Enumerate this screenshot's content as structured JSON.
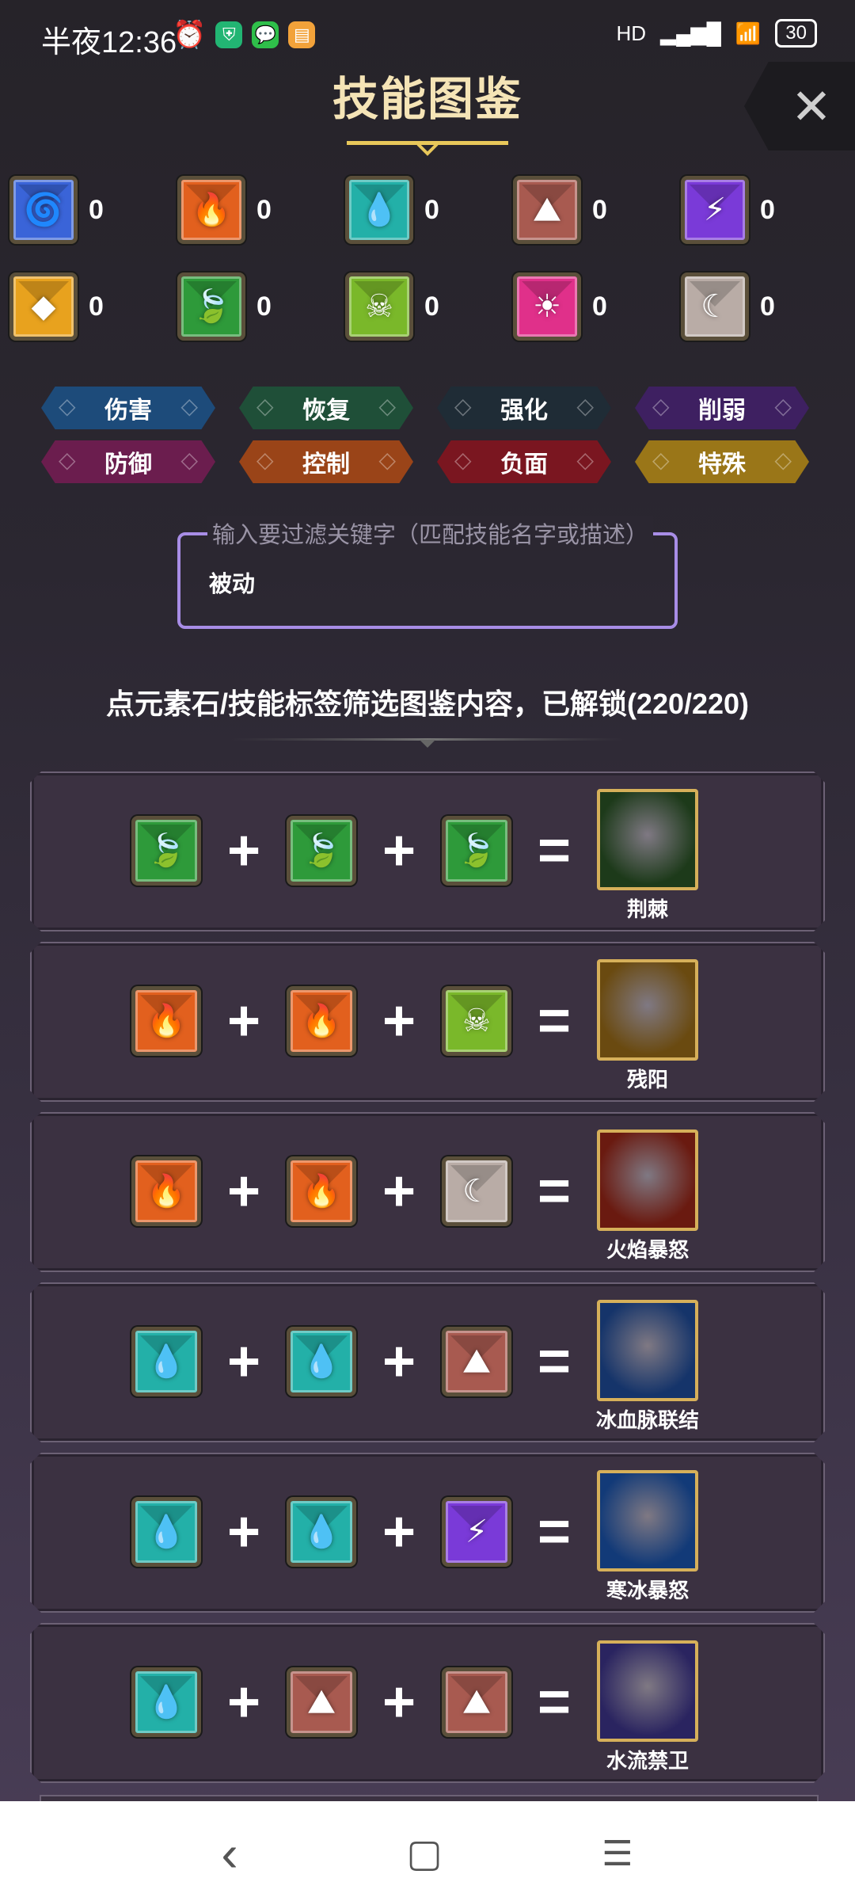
{
  "status_bar": {
    "time": "半夜12:36",
    "network": "HD",
    "battery": "30"
  },
  "page": {
    "title": "技能图鉴",
    "close_glyph": "✕"
  },
  "elements": [
    {
      "name": "wind",
      "icon": "tornado-icon",
      "glyph": "🌀",
      "color": "#3a64d8",
      "count": "0"
    },
    {
      "name": "fire",
      "icon": "flame-icon",
      "glyph": "🔥",
      "color": "#e2601e",
      "count": "0"
    },
    {
      "name": "water",
      "icon": "water-drop-icon",
      "glyph": "💧",
      "color": "#23b0a8",
      "count": "0"
    },
    {
      "name": "earth",
      "icon": "rock-icon",
      "glyph": "⛰",
      "color": "#a85a50",
      "count": "0"
    },
    {
      "name": "thunder",
      "icon": "lightning-icon",
      "glyph": "⚡",
      "color": "#7a3ad8",
      "count": "0"
    },
    {
      "name": "metal",
      "icon": "gold-gem-icon",
      "glyph": "◆",
      "color": "#e8a21e",
      "count": "0"
    },
    {
      "name": "wood",
      "icon": "leaf-icon",
      "glyph": "🍃",
      "color": "#2e9a3a",
      "count": "0"
    },
    {
      "name": "poison",
      "icon": "skull-icon",
      "glyph": "☠",
      "color": "#7ab82a",
      "count": "0"
    },
    {
      "name": "light",
      "icon": "sun-icon",
      "glyph": "☀",
      "color": "#e0308a",
      "count": "0"
    },
    {
      "name": "dark",
      "icon": "moon-icon",
      "glyph": "☾",
      "color": "#b9aca6",
      "count": "0"
    }
  ],
  "tags": [
    {
      "label": "伤害",
      "color": "#1d4b7a"
    },
    {
      "label": "恢复",
      "color": "#1f4f38"
    },
    {
      "label": "强化",
      "color": "#1f2c36"
    },
    {
      "label": "削弱",
      "color": "#3e2061"
    },
    {
      "label": "防御",
      "color": "#6b1d4e"
    },
    {
      "label": "控制",
      "color": "#9a4418"
    },
    {
      "label": "负面",
      "color": "#7a1620"
    },
    {
      "label": "特殊",
      "color": "#9a7618"
    }
  ],
  "search": {
    "placeholder": "输入要过滤关键字（匹配技能名字或描述）",
    "value": "被动"
  },
  "hint": "点元素石/技能标签筛选图鉴内容，已解锁(220/220)",
  "recipes": [
    {
      "inputs": [
        "wood",
        "wood",
        "wood"
      ],
      "result": "荆棘",
      "art": "thorns-art",
      "bg": "#1d3a1a"
    },
    {
      "inputs": [
        "fire",
        "fire",
        "poison"
      ],
      "result": "残阳",
      "art": "sunset-art",
      "bg": "#6a4a10"
    },
    {
      "inputs": [
        "fire",
        "fire",
        "dark"
      ],
      "result": "火焰暴怒",
      "art": "flame-fury-art",
      "bg": "#6a1a10"
    },
    {
      "inputs": [
        "water",
        "water",
        "earth"
      ],
      "result": "冰血脉联结",
      "art": "ice-blood-art",
      "bg": "#15346a"
    },
    {
      "inputs": [
        "water",
        "water",
        "thunder"
      ],
      "result": "寒冰暴怒",
      "art": "ice-fury-art",
      "bg": "#123a78"
    },
    {
      "inputs": [
        "water",
        "earth",
        "earth"
      ],
      "result": "水流禁卫",
      "art": "water-guard-art",
      "bg": "#2a2460"
    }
  ],
  "navbar": {
    "back": "‹",
    "home": "▢",
    "menu": "☰"
  }
}
